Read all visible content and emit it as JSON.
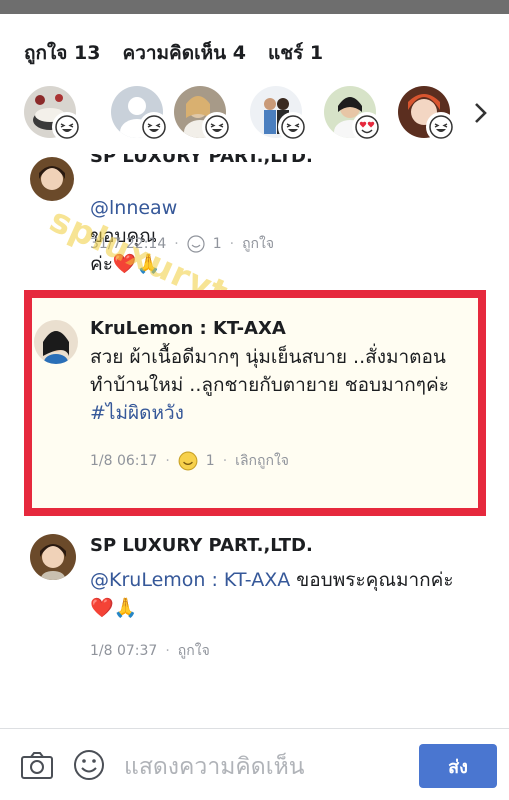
{
  "stats": {
    "likes": "ถูกใจ 13",
    "comments": "ความคิดเห็น 4",
    "shares": "แชร์ 1"
  },
  "reactors": [
    {
      "reaction": "haha"
    },
    {
      "reaction": "haha"
    },
    {
      "reaction": "haha"
    },
    {
      "reaction": "haha"
    },
    {
      "reaction": "love"
    },
    {
      "reaction": "haha"
    }
  ],
  "watermark": "spluxurytrading.com",
  "comments": [
    {
      "author": "SP LUXURY PART.,LTD.",
      "mention": "@lnneaw",
      "text": " ขอบคุณค่ะ❤️🙏",
      "time": "31/7 22:14",
      "reactions": "1",
      "action": "ถูกใจ"
    },
    {
      "author": "KruLemon : KT-AXA",
      "text": "สวย ผ้าเนื้อดีมากๆ นุ่มเย็นสบาย ..สั่งมาตอนทำบ้านใหม่ ..ลูกชายกับตายาย ชอบมากๆค่ะ ",
      "hashtag": "#ไม่ผิดหวัง",
      "time": "1/8 06:17",
      "reactions": "1",
      "action": "เลิกถูกใจ"
    },
    {
      "author": "SP LUXURY PART.,LTD.",
      "mention": "@KruLemon : KT-AXA",
      "text": " ขอบพระคุณมากค่ะ❤️🙏",
      "time": "1/8 07:37",
      "action": "ถูกใจ"
    }
  ],
  "composer": {
    "placeholder": "แสดงความคิดเห็น",
    "send": "ส่ง"
  },
  "colors": {
    "highlight": "#e6293d",
    "link": "#365899",
    "send": "#4a76d0"
  }
}
